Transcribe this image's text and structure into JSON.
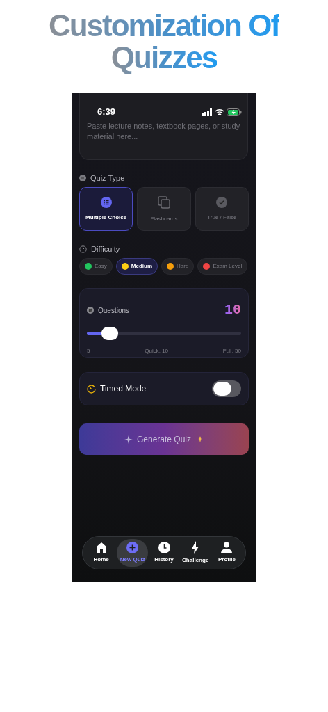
{
  "headline": [
    "Customization Of",
    "Quizzes"
  ],
  "status_bar": {
    "time": "6:39"
  },
  "notes_field": {
    "placeholder": "Paste lecture notes, textbook pages, or study material here..."
  },
  "quiz_type": {
    "label": "Quiz Type",
    "options": [
      {
        "label": "Multiple Choice",
        "kind": "list",
        "selected": true
      },
      {
        "label": "Flashcards",
        "kind": "cards",
        "selected": false
      },
      {
        "label": "True / False",
        "kind": "check",
        "selected": false
      }
    ]
  },
  "difficulty": {
    "label": "Difficulty",
    "options": [
      {
        "label": "Easy",
        "color": "#22c55e",
        "selected": false
      },
      {
        "label": "Medium",
        "color": "#facc15",
        "selected": true
      },
      {
        "label": "Hard",
        "color": "#f59e0b",
        "selected": false
      },
      {
        "label": "Exam Level",
        "color": "#ef4444",
        "selected": false
      }
    ]
  },
  "questions": {
    "label": "Questions",
    "value": "10",
    "level": 0.15,
    "min_label": "5",
    "mid_label": "Quick: 10",
    "max_label": "Full: 50"
  },
  "timed_mode": {
    "label": "Timed Mode",
    "on": false
  },
  "generate_button": {
    "label": "Generate Quiz"
  },
  "nav": [
    {
      "label": "Home",
      "kind": "home",
      "selected": false
    },
    {
      "label": "New Quiz",
      "kind": "plus",
      "selected": true
    },
    {
      "label": "History",
      "kind": "clock",
      "selected": false
    },
    {
      "label": "Challenge",
      "kind": "bolt",
      "selected": false
    },
    {
      "label": "Profile",
      "kind": "person",
      "selected": false
    }
  ]
}
